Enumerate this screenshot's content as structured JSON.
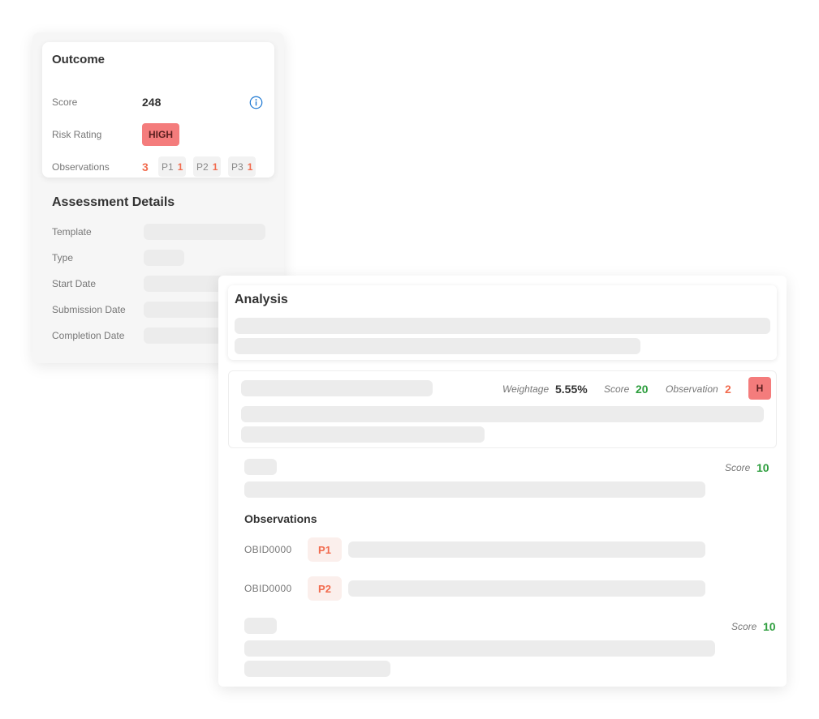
{
  "outcome": {
    "title": "Outcome",
    "score_label": "Score",
    "score_value": "248",
    "risk_rating_label": "Risk Rating",
    "risk_rating_value": "HIGH",
    "observations_label": "Observations",
    "observations_total": "3",
    "priorities": [
      {
        "label": "P1",
        "count": "1"
      },
      {
        "label": "P2",
        "count": "1"
      },
      {
        "label": "P3",
        "count": "1"
      }
    ]
  },
  "assessment_details": {
    "title": "Assessment Details",
    "fields": [
      {
        "label": "Template"
      },
      {
        "label": "Type"
      },
      {
        "label": "Start Date"
      },
      {
        "label": "Submission Date"
      },
      {
        "label": "Completion Date"
      }
    ]
  },
  "analysis": {
    "title": "Analysis",
    "section": {
      "weightage_label": "Weightage",
      "weightage_value": "5.55%",
      "score_label": "Score",
      "score_value": "20",
      "observation_label": "Observation",
      "observation_value": "2",
      "risk_badge": "H"
    },
    "questions": [
      {
        "score_label": "Score",
        "score_value": "10"
      },
      {
        "score_label": "Score",
        "score_value": "10"
      }
    ],
    "observations": {
      "title": "Observations",
      "items": [
        {
          "id": "OBID0000",
          "priority": "P1"
        },
        {
          "id": "OBID0000",
          "priority": "P2"
        }
      ]
    }
  },
  "colors": {
    "accent_red": "#f26c4f",
    "risk_badge": "#f47c7c",
    "score_green": "#2e9e3e",
    "info_blue": "#1976d2"
  },
  "icons": {
    "info": "info-icon"
  }
}
